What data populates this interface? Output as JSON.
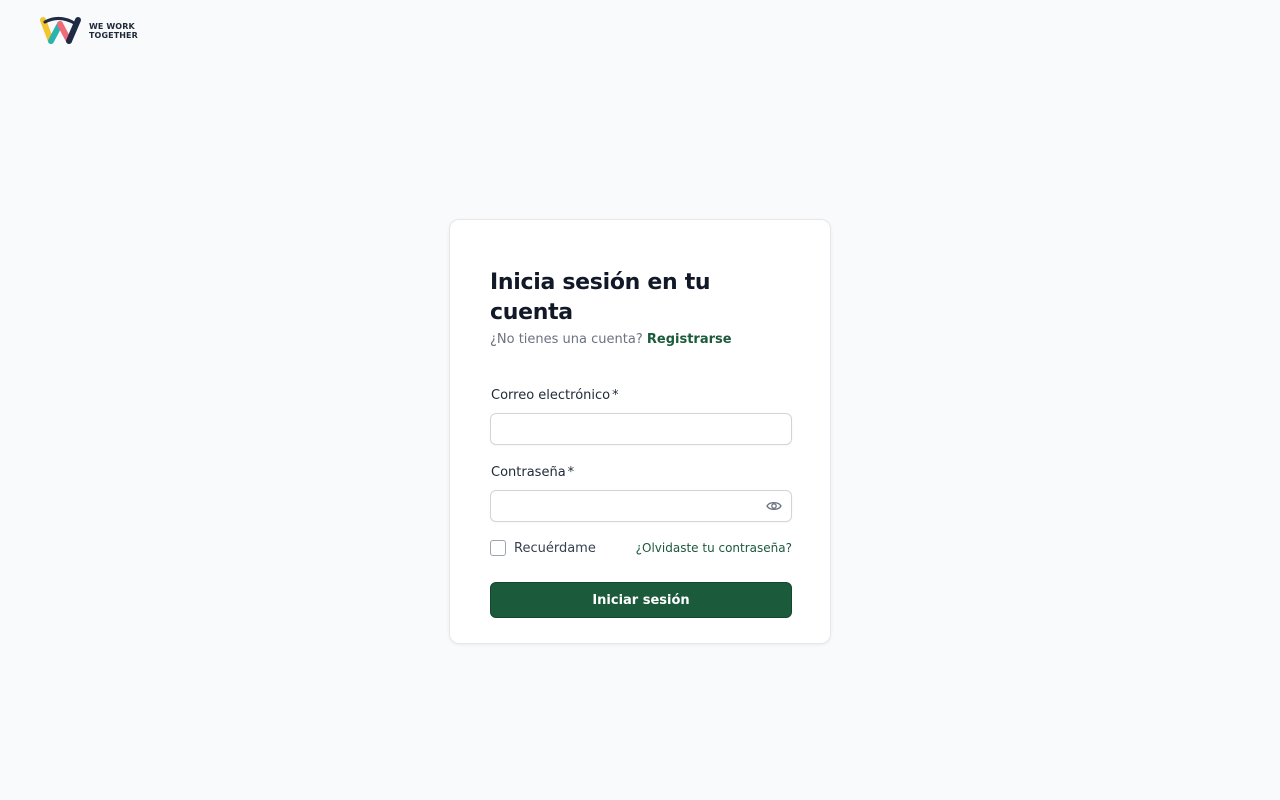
{
  "brand": {
    "logo_line1": "WE WORK",
    "logo_line2": "TOGETHER",
    "logo_icon": "w-logo-icon"
  },
  "login": {
    "title": "Inicia sesión en tu cuenta",
    "no_account_text": "¿No tienes una cuenta?",
    "register_link": "Registrarse",
    "email_label": "Correo electrónico",
    "email_value": "",
    "email_placeholder": "",
    "password_label": "Contraseña",
    "password_value": "",
    "password_placeholder": "",
    "required_mark": "*",
    "toggle_visibility_icon": "eye-icon",
    "remember_label": "Recuérdame",
    "remember_checked": false,
    "forgot_link": "¿Olvidaste tu contraseña?",
    "submit_label": "Iniciar sesión"
  },
  "colors": {
    "primary": "#1c5a3c",
    "background": "#f9fafb",
    "card": "#ffffff"
  }
}
